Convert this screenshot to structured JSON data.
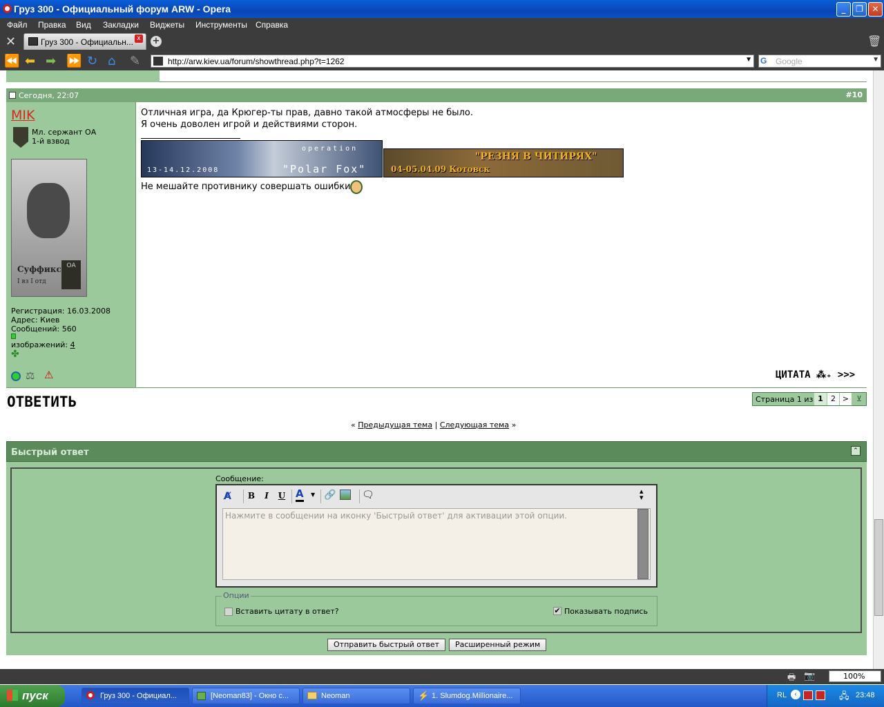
{
  "window": {
    "title": "Груз 300 - Официальный форум ARW - Opera"
  },
  "menu": [
    "Файл",
    "Правка",
    "Вид",
    "Закладки",
    "Виджеты",
    "Инструменты",
    "Справка"
  ],
  "tab": {
    "label": "Груз 300 - Официальн..."
  },
  "address": {
    "url": "http://arw.kiev.ua/forum/showthread.php?t=1262"
  },
  "search": {
    "placeholder": "Google"
  },
  "post": {
    "date": "Сегодня, 22:07",
    "number": "#10",
    "username": "MIK",
    "rank": "Мл. сержант ОА",
    "unit": "1-й взвод",
    "avatar_caption": "Суффикс",
    "avatar_sub": "I вз I отд",
    "avatar_badge": "ОА",
    "registration": "Регистрация: 16.03.2008",
    "address": "Адрес: Киев",
    "messages": "Сообщений: 560",
    "images_label": "изображений:",
    "images_count": "4",
    "body_line1": "Отличная игра, да Крюгер-ты прав, давно такой атмосферы не было.",
    "body_line2": "Я очень доволен игрой и действиями сторон.",
    "banner1_op": "operation",
    "banner1_dates": "13-14.12.2008",
    "banner1_name": "\"Polar Fox\"",
    "banner2_title": "\"РЕЗНЯ В ЧИТИРЯХ\"",
    "banner2_sub": "04-05.04.09 Котовск",
    "signature": "Не мешайте противнику совершать ошибки",
    "quote_label": "ЦИТАТА"
  },
  "reply_button": "ОТВЕТИТЬ",
  "pagination": {
    "label": "Страница 1 из 2",
    "current": "1",
    "next_page": "2",
    "next": ">"
  },
  "thread_nav": {
    "prev": "Предыдущая тема",
    "sep": "|",
    "next": "Следующая тема"
  },
  "quick_reply": {
    "title": "Быстрый ответ",
    "message_label": "Сообщение:",
    "placeholder": "Нажмите в сообщении на иконку 'Быстрый ответ' для активации этой опции.",
    "options_legend": "Опции",
    "insert_quote": "Вставить цитату в ответ?",
    "show_signature": "Показывать подпись",
    "submit": "Отправить быстрый ответ",
    "advanced": "Расширенный режим"
  },
  "status": {
    "zoom": "100%"
  },
  "taskbar": {
    "start": "пуск",
    "tasks": [
      "Груз 300 - Официал...",
      "[Neoman83] - Окно с...",
      "Neoman",
      "1. Slumdog.Millionaire..."
    ],
    "lang": "RL",
    "time": "23:48"
  }
}
